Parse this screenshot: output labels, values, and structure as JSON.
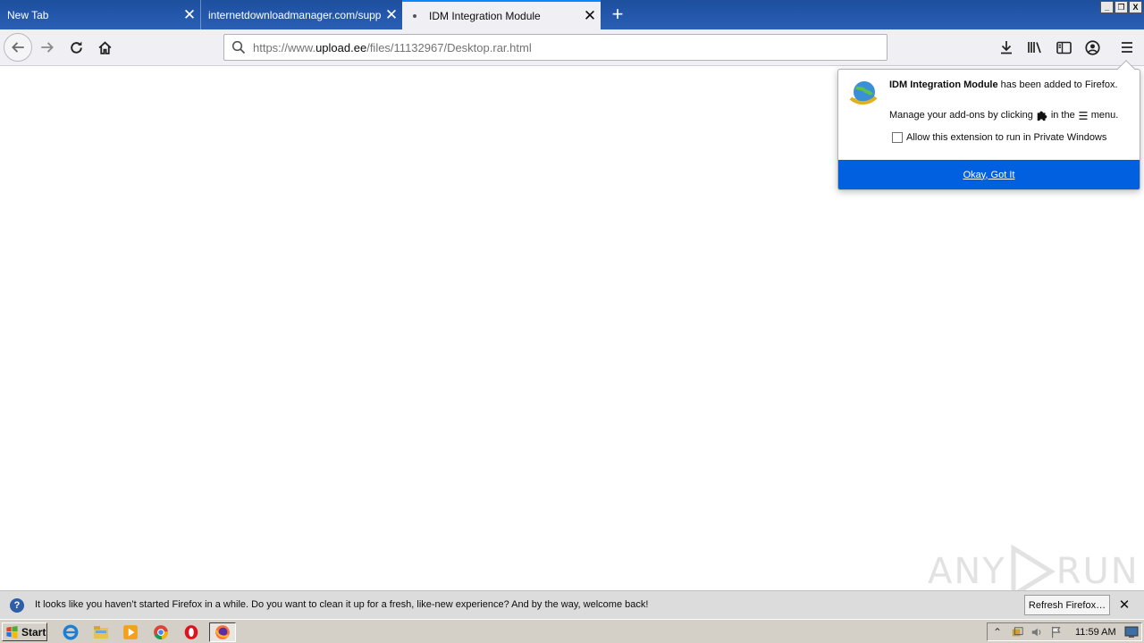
{
  "tabs": [
    {
      "label": "New Tab",
      "active": false
    },
    {
      "label": "internetdownloadmanager.com/support",
      "active": false
    },
    {
      "label": "IDM Integration Module",
      "active": true
    }
  ],
  "window_controls": {
    "minimize": "_",
    "restore": "❐",
    "close": "X"
  },
  "urlbar": {
    "prefix": "https://www.",
    "host": "upload.ee",
    "path": "/files/11132967/Desktop.rar.html"
  },
  "doorhanger": {
    "addon_name": "IDM Integration Module",
    "added_text": " has been added to Firefox.",
    "manage_before": "Manage your add-ons by clicking",
    "manage_middle": "in the",
    "manage_after": "menu.",
    "private_label": "Allow this extension to run in Private Windows",
    "private_checked": false,
    "ok_label": "Okay, Got It"
  },
  "notification": {
    "text": "It looks like you haven’t started Firefox in a while. Do you want to clean it up for a fresh, like-new experience? And by the way, welcome back!",
    "button": "Refresh Firefox…"
  },
  "taskbar": {
    "start_label": "Start",
    "apps": [
      "internet-explorer",
      "file-explorer",
      "media-player",
      "chrome",
      "opera",
      "firefox"
    ],
    "clock": "11:59 AM"
  },
  "watermark": {
    "left": "ANY",
    "right": "RUN"
  },
  "colors": {
    "accent": "#0a84ff",
    "button_primary": "#0060df",
    "tabstrip": "#1d4f9e"
  }
}
